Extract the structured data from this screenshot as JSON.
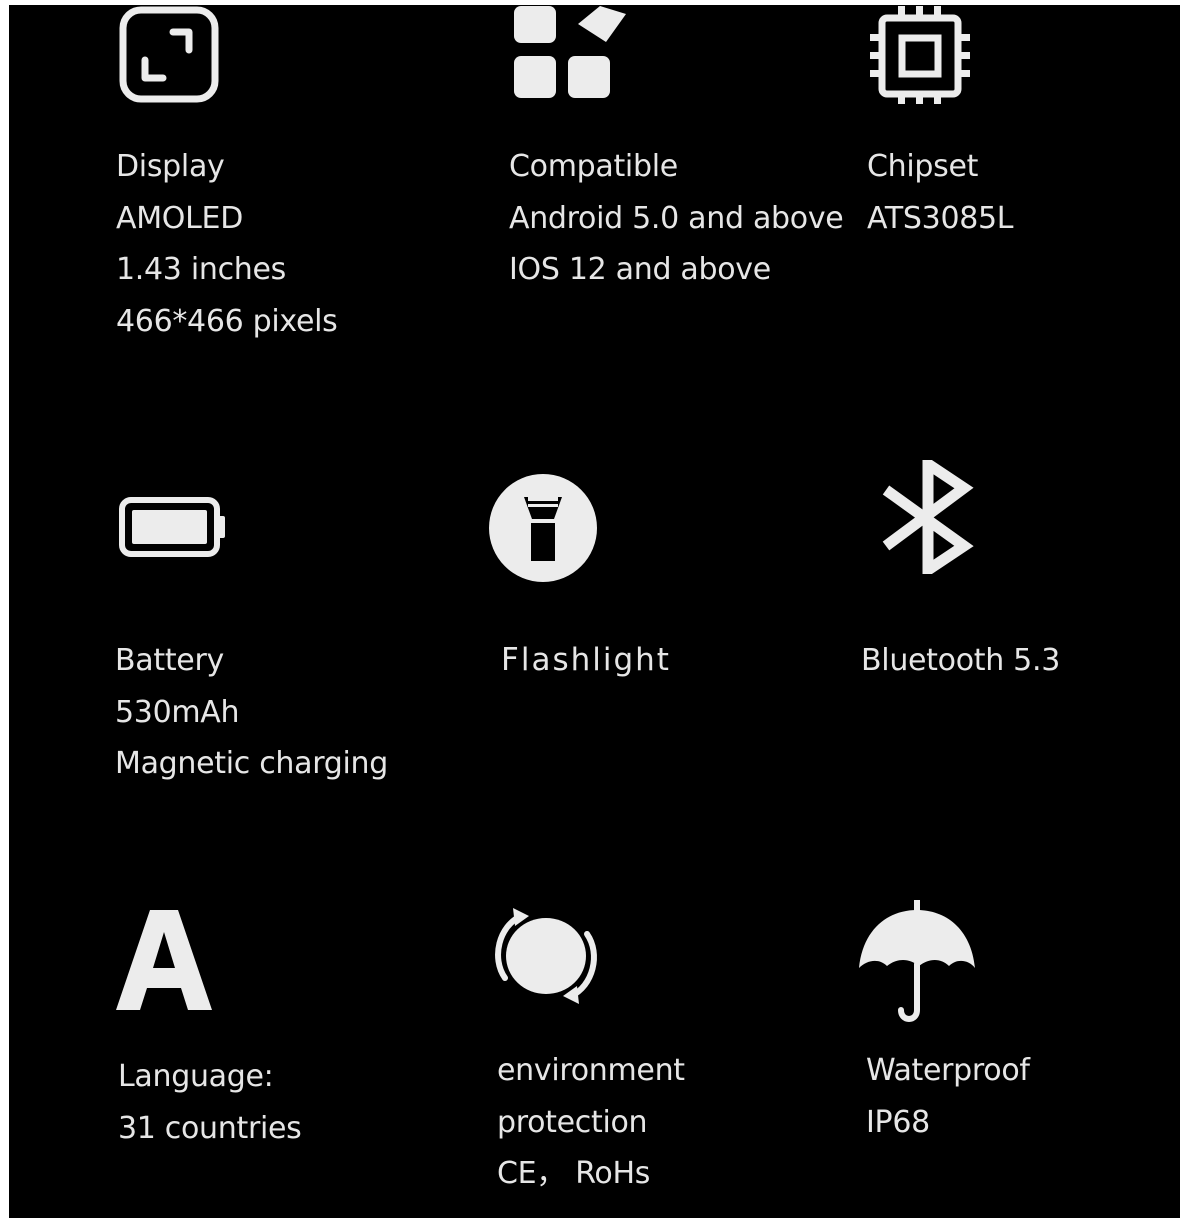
{
  "features": [
    {
      "icon": "expand-screen-icon",
      "lines": [
        "Display",
        "AMOLED",
        "1.43 inches",
        "466*466 pixels"
      ]
    },
    {
      "icon": "apps-grid-icon",
      "lines": [
        "Compatible",
        "Android 5.0 and above",
        "IOS 12 and above"
      ]
    },
    {
      "icon": "chipset-icon",
      "lines": [
        "Chipset",
        "ATS3085L"
      ]
    },
    {
      "icon": "battery-icon",
      "lines": [
        "Battery",
        "530mAh",
        "Magnetic charging"
      ]
    },
    {
      "icon": "flashlight-icon",
      "lines": [
        "Flashlight"
      ]
    },
    {
      "icon": "bluetooth-icon",
      "lines": [
        "Bluetooth 5.3"
      ]
    },
    {
      "icon": "language-letter-a-icon",
      "lines": [
        "Language:",
        "31 countries"
      ]
    },
    {
      "icon": "recycle-globe-icon",
      "lines": [
        "environment",
        "protection",
        "CE， RoHs"
      ]
    },
    {
      "icon": "umbrella-icon",
      "lines": [
        "Waterproof",
        "IP68"
      ]
    }
  ],
  "colors": {
    "background": "#000000",
    "text": "#e6e6e6",
    "icon": "#ececec"
  }
}
